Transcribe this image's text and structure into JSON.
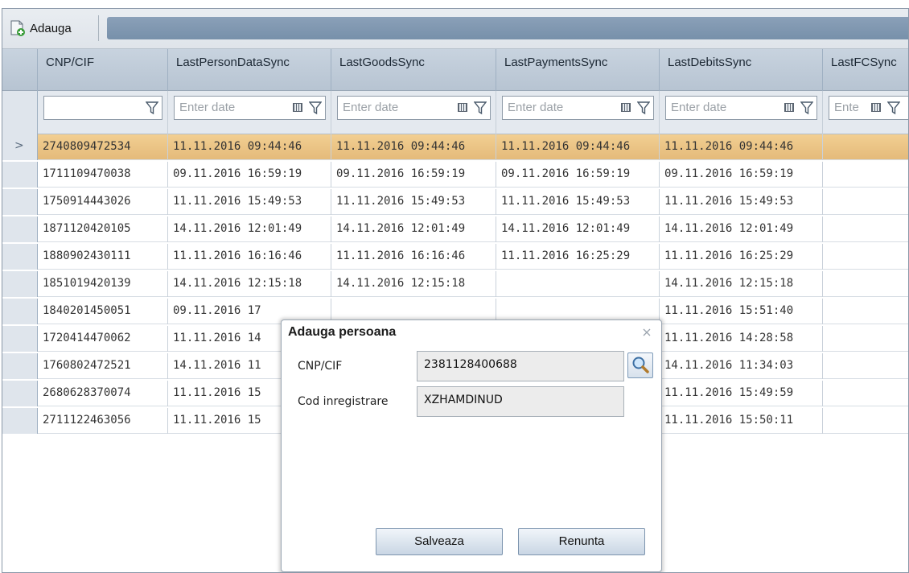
{
  "toolbar": {
    "add_label": "Adauga"
  },
  "grid": {
    "columns": [
      "CNP/CIF",
      "LastPersonDataSync",
      "LastGoodsSync",
      "LastPaymentsSync",
      "LastDebitsSync",
      "LastFCSync"
    ],
    "date_placeholder": "Enter date",
    "date_placeholder_short": "Ente",
    "selector_glyph": ">",
    "rows": [
      [
        "2740809472534",
        "11.11.2016 09:44:46",
        "11.11.2016 09:44:46",
        "11.11.2016 09:44:46",
        "11.11.2016 09:44:46"
      ],
      [
        "1711109470038",
        "09.11.2016 16:59:19",
        "09.11.2016 16:59:19",
        "09.11.2016 16:59:19",
        "09.11.2016 16:59:19"
      ],
      [
        "1750914443026",
        "11.11.2016 15:49:53",
        "11.11.2016 15:49:53",
        "11.11.2016 15:49:53",
        "11.11.2016 15:49:53"
      ],
      [
        "1871120420105",
        "14.11.2016 12:01:49",
        "14.11.2016 12:01:49",
        "14.11.2016 12:01:49",
        "14.11.2016 12:01:49"
      ],
      [
        "1880902430111",
        "11.11.2016 16:16:46",
        "11.11.2016 16:16:46",
        "11.11.2016 16:25:29",
        "11.11.2016 16:25:29"
      ],
      [
        "1851019420139",
        "14.11.2016 12:15:18",
        "14.11.2016 12:15:18",
        "",
        "14.11.2016 12:15:18"
      ],
      [
        "1840201450051",
        "09.11.2016 17",
        "",
        "",
        "11.11.2016 15:51:40"
      ],
      [
        "1720414470062",
        "11.11.2016 14",
        "",
        "",
        "11.11.2016 14:28:58"
      ],
      [
        "1760802472521",
        "14.11.2016 11",
        "",
        "",
        "14.11.2016 11:34:03"
      ],
      [
        "2680628370074",
        "11.11.2016 15",
        "",
        "",
        "11.11.2016 15:49:59"
      ],
      [
        "2711122463056",
        "11.11.2016 15",
        "",
        "",
        "11.11.2016 15:50:11"
      ]
    ]
  },
  "modal": {
    "title": "Adauga persoana",
    "cnp_label": "CNP/CIF",
    "cnp_value": "2381128400688",
    "cod_label": "Cod inregistrare",
    "cod_value": "XZHAMDINUD",
    "save_label": "Salveaza",
    "cancel_label": "Renunta"
  },
  "colors": {
    "selected_row": "#e9c283",
    "header": "#bfcbd8",
    "toolbar_strip": "#7f97b0"
  }
}
